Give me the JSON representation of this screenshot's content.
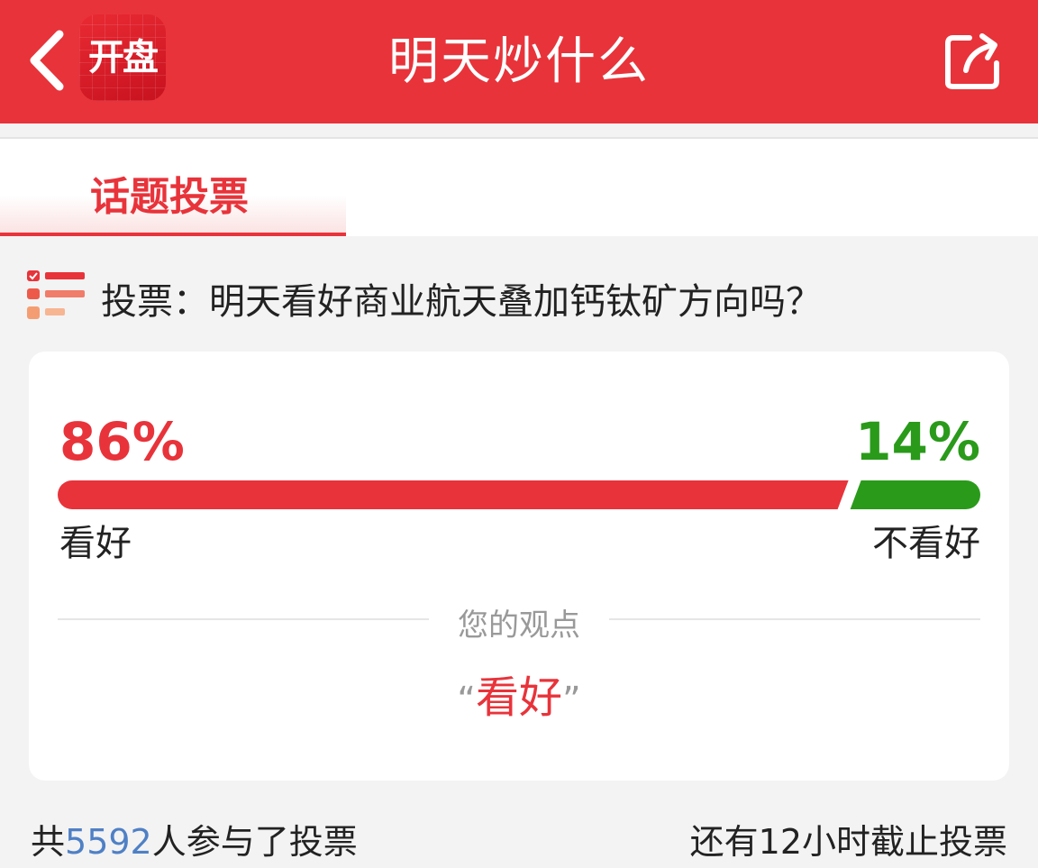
{
  "header": {
    "logo_text": "开盘",
    "title": "明天炒什么",
    "back_icon": "chevron-left-icon",
    "share_icon": "share-icon"
  },
  "tabs": [
    {
      "label": "话题投票",
      "active": true
    }
  ],
  "question": {
    "icon": "vote-list-icon",
    "text": "投票：明天看好商业航天叠加钙钛矿方向吗？"
  },
  "poll": {
    "bullish_percent": 86,
    "bearish_percent": 14,
    "bullish_percent_label": "86%",
    "bearish_percent_label": "14%",
    "bullish_label": "看好",
    "bearish_label": "不看好",
    "colors": {
      "bullish": "#e8333a",
      "bearish": "#2a9a1a"
    }
  },
  "my_view": {
    "caption": "您的观点",
    "open_quote": "“",
    "choice": "看好",
    "close_quote": "”"
  },
  "footer": {
    "prefix": "共",
    "count": "5592",
    "suffix": "人参与了投票",
    "deadline": "还有12小时截止投票"
  }
}
